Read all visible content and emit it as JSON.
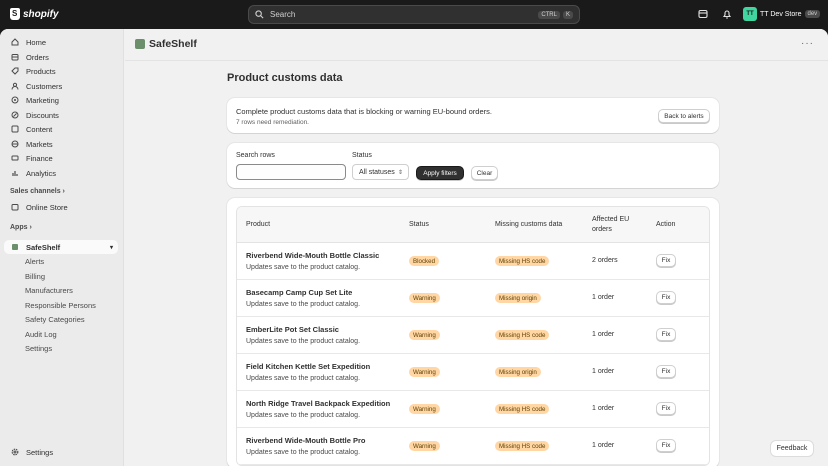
{
  "topbar": {
    "brand": "shopify",
    "search_placeholder": "Search",
    "shortcut_keys": [
      "CTRL",
      "K"
    ],
    "store_name": "TT Dev Store",
    "store_badge": "dev"
  },
  "sidebar": {
    "items": [
      {
        "label": "Home",
        "icon": "home-icon"
      },
      {
        "label": "Orders",
        "icon": "orders-icon"
      },
      {
        "label": "Products",
        "icon": "products-icon"
      },
      {
        "label": "Customers",
        "icon": "customers-icon"
      },
      {
        "label": "Marketing",
        "icon": "marketing-icon"
      },
      {
        "label": "Discounts",
        "icon": "discounts-icon"
      },
      {
        "label": "Content",
        "icon": "content-icon"
      },
      {
        "label": "Markets",
        "icon": "markets-icon"
      },
      {
        "label": "Finance",
        "icon": "finance-icon"
      },
      {
        "label": "Analytics",
        "icon": "analytics-icon"
      }
    ],
    "sales_channels_label": "Sales channels",
    "online_store": "Online Store",
    "apps_label": "Apps",
    "app_name": "SafeShelf",
    "app_subitems": [
      "Alerts",
      "Billing",
      "Manufacturers",
      "Responsible Persons",
      "Safety Categories",
      "Audit Log",
      "Settings"
    ],
    "settings": "Settings"
  },
  "appbar": {
    "title": "SafeShelf"
  },
  "page": {
    "title": "Product customs data",
    "intro_text": "Complete product customs data that is blocking or warning EU-bound orders.",
    "intro_sub": "7 rows need remediation.",
    "back_button": "Back to alerts"
  },
  "filters": {
    "search_label": "Search rows",
    "search_value": "",
    "status_label": "Status",
    "status_value": "All statuses",
    "apply_button": "Apply filters",
    "clear_button": "Clear"
  },
  "table": {
    "headers": [
      "Product",
      "Status",
      "Missing customs data",
      "Affected EU orders",
      "Action"
    ],
    "rows": [
      {
        "name": "Riverbend Wide-Mouth Bottle Classic",
        "sub": "Updates save to the product catalog.",
        "status": "Blocked",
        "missing": "Missing HS code",
        "orders": "2 orders",
        "action": "Fix"
      },
      {
        "name": "Basecamp Camp Cup Set Lite",
        "sub": "Updates save to the product catalog.",
        "status": "Warning",
        "missing": "Missing origin",
        "orders": "1 order",
        "action": "Fix"
      },
      {
        "name": "EmberLite Pot Set Classic",
        "sub": "Updates save to the product catalog.",
        "status": "Warning",
        "missing": "Missing HS code",
        "orders": "1 order",
        "action": "Fix"
      },
      {
        "name": "Field Kitchen Kettle Set Expedition",
        "sub": "Updates save to the product catalog.",
        "status": "Warning",
        "missing": "Missing origin",
        "orders": "1 order",
        "action": "Fix"
      },
      {
        "name": "North Ridge Travel Backpack Expedition",
        "sub": "Updates save to the product catalog.",
        "status": "Warning",
        "missing": "Missing HS code",
        "orders": "1 order",
        "action": "Fix"
      },
      {
        "name": "Riverbend Wide-Mouth Bottle Pro",
        "sub": "Updates save to the product catalog.",
        "status": "Warning",
        "missing": "Missing HS code",
        "orders": "1 order",
        "action": "Fix"
      }
    ]
  },
  "feedback_button": "Feedback",
  "colors": {
    "topbar": "#1a1a1a",
    "badge_bg": "#ffd6a4",
    "primary_button": "#303030"
  }
}
